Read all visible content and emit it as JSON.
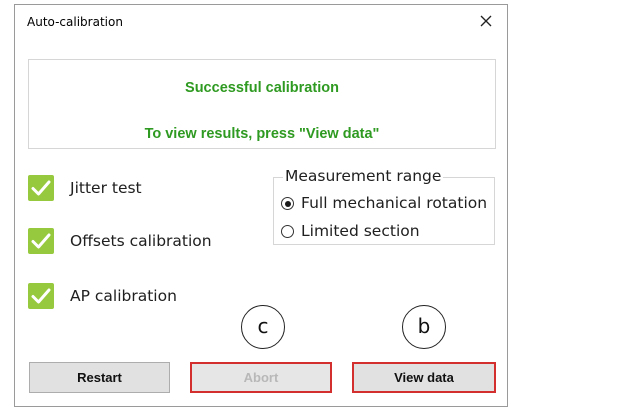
{
  "window": {
    "title": "Auto-calibration",
    "close_icon": "close-icon"
  },
  "message": {
    "line1": "Successful calibration",
    "line2": "To view results, press \"View data\"",
    "color": "#2f9a21"
  },
  "checks": [
    {
      "label": "Jitter test",
      "checked": true
    },
    {
      "label": "Offsets calibration",
      "checked": true
    },
    {
      "label": "AP calibration",
      "checked": true
    }
  ],
  "check_color": "#96c93d",
  "measurement_range": {
    "title": "Measurement range",
    "options": [
      {
        "label": "Full mechanical rotation",
        "selected": true
      },
      {
        "label": "Limited section",
        "selected": false
      }
    ]
  },
  "markers": {
    "c": "c",
    "b": "b"
  },
  "buttons": {
    "restart": "Restart",
    "abort": "Abort",
    "view_data": "View data"
  },
  "highlight_color": "#d32f2f"
}
